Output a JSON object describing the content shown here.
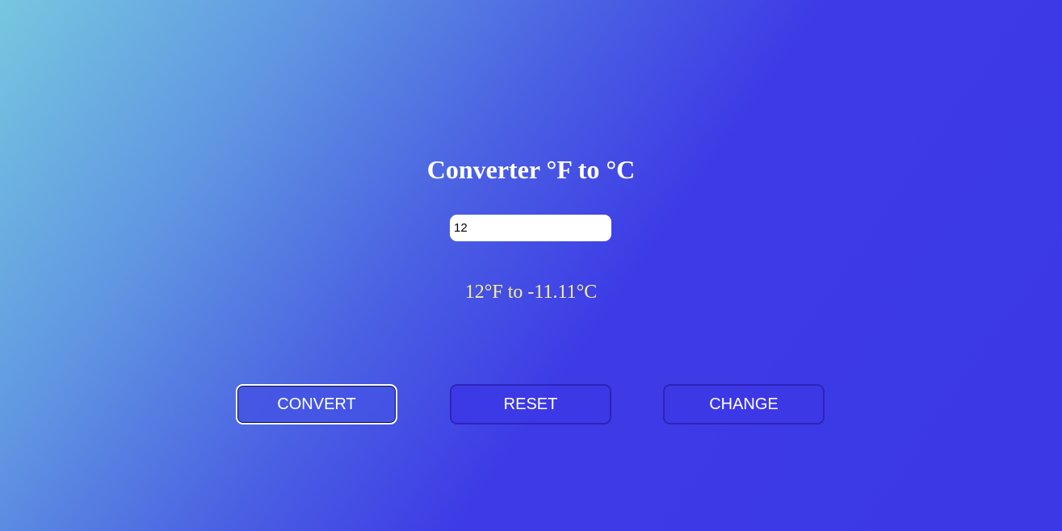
{
  "converter": {
    "title": "Converter °F to °C",
    "input_value": "12",
    "result_text": "12°F to -11.11°C"
  },
  "buttons": {
    "convert_label": "CONVERT",
    "reset_label": "RESET",
    "change_label": "CHANGE"
  },
  "colors": {
    "background_start": "#76c7e0",
    "background_end": "#3c38e6",
    "result_text": "#f3ee9a",
    "button_border": "#2d24b8"
  }
}
